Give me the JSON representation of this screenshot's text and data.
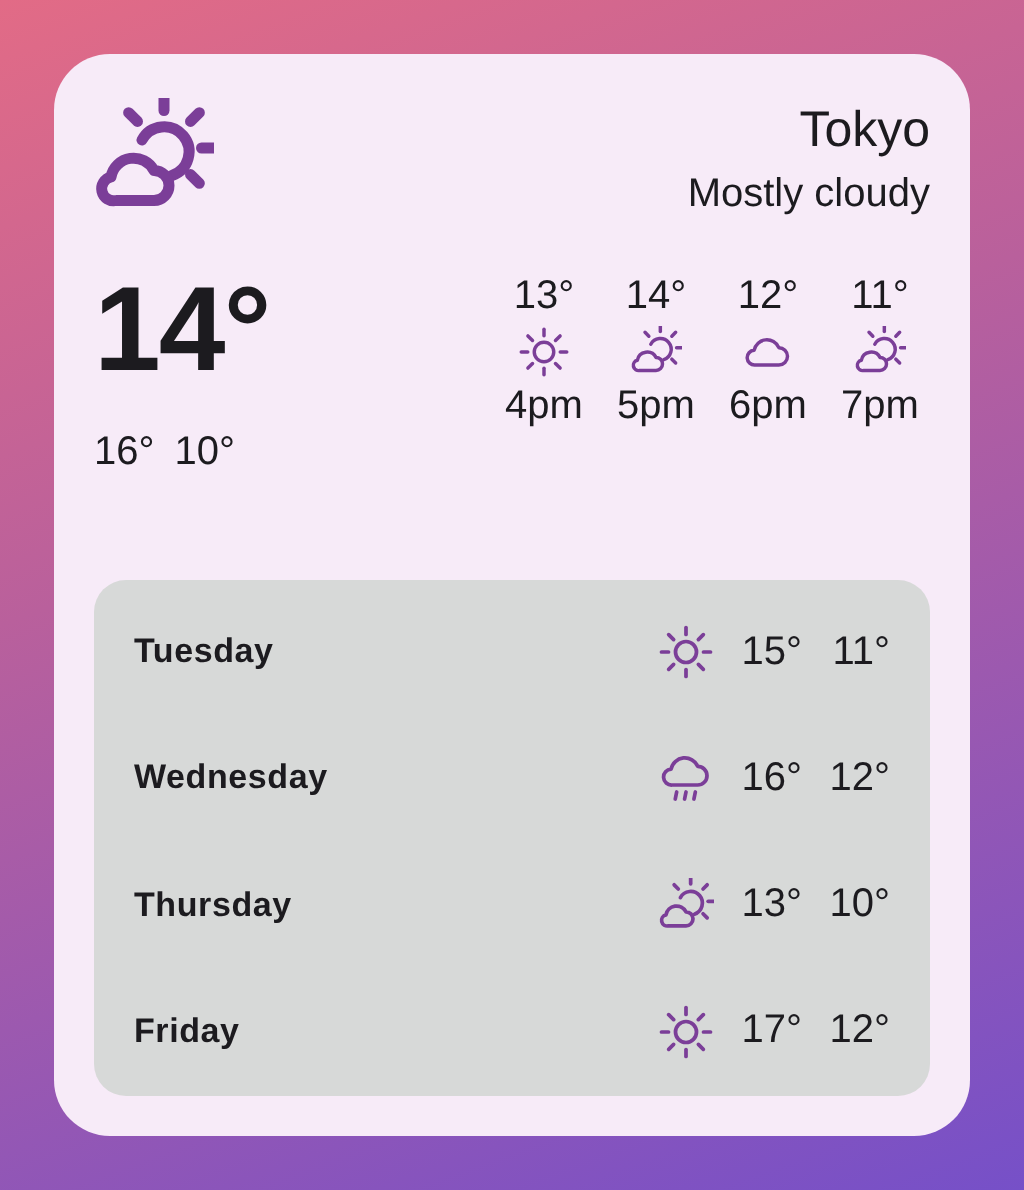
{
  "current": {
    "kind": "partly-cloudy",
    "city": "Tokyo",
    "condition": "Mostly cloudy",
    "temperature": "14°",
    "high": "16°",
    "low": "10°"
  },
  "hourly": [
    {
      "temp": "13°",
      "kind": "sunny",
      "time": "4pm"
    },
    {
      "temp": "14°",
      "kind": "partly-cloudy",
      "time": "5pm"
    },
    {
      "temp": "12°",
      "kind": "cloudy",
      "time": "6pm"
    },
    {
      "temp": "11°",
      "kind": "partly-cloudy",
      "time": "7pm"
    }
  ],
  "daily": [
    {
      "day": "Tuesday",
      "kind": "sunny",
      "high": "15°",
      "low": "11°"
    },
    {
      "day": "Wednesday",
      "kind": "rain",
      "high": "16°",
      "low": "12°"
    },
    {
      "day": "Thursday",
      "kind": "partly-cloudy",
      "high": "13°",
      "low": "10°"
    },
    {
      "day": "Friday",
      "kind": "sunny",
      "high": "17°",
      "low": "12°"
    }
  ]
}
